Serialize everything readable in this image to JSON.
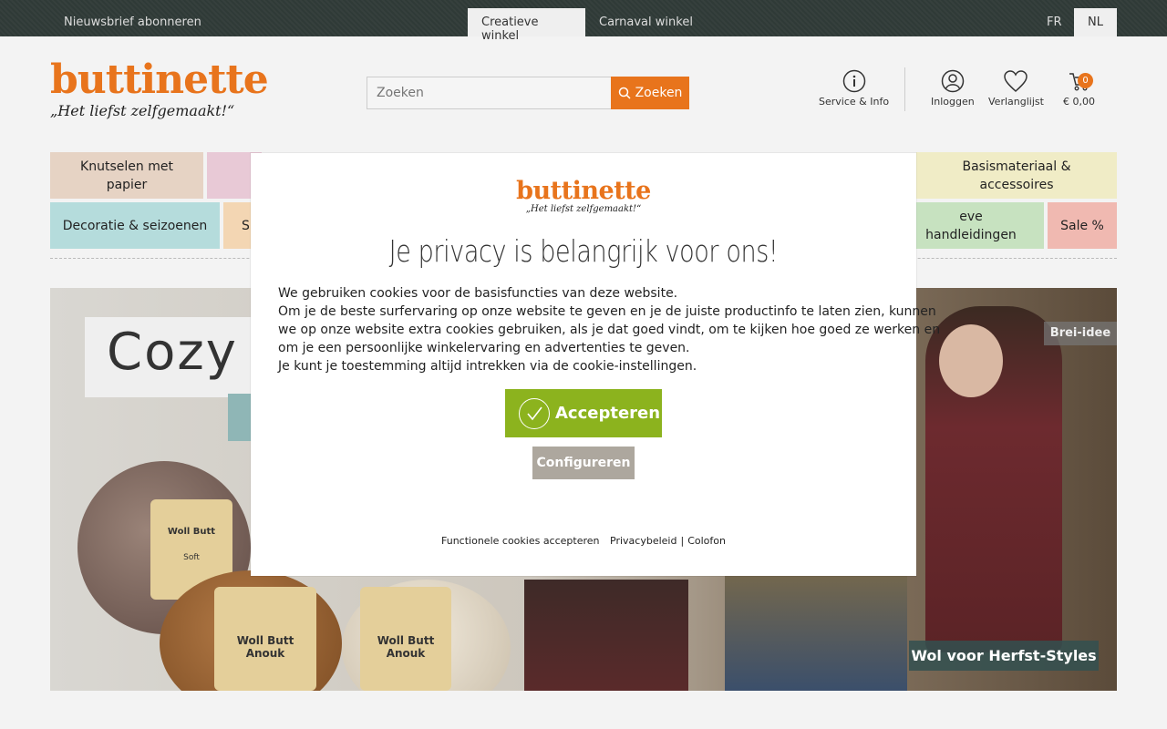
{
  "topbar": {
    "newsletter": "Nieuwsbrief abonneren",
    "tabs": [
      {
        "label": "Creatieve winkel",
        "active": true
      },
      {
        "label": "Carnaval winkel",
        "active": false
      }
    ],
    "languages": [
      {
        "label": "FR",
        "active": false
      },
      {
        "label": "NL",
        "active": true
      }
    ]
  },
  "header": {
    "logo_text": "buttinette",
    "tagline": "„Het liefst zelfgemaakt!“",
    "search": {
      "placeholder": "Zoeken",
      "button_label": "Zoeken"
    },
    "icons": {
      "service": "Service & Info",
      "login": "Inloggen",
      "wishlist": "Verlanglijst",
      "cart_total": "€ 0,00",
      "cart_count": "0"
    }
  },
  "categories": {
    "row1": [
      {
        "label": "Knutselen met papier",
        "color": "#e6d3c4"
      },
      {
        "label": "",
        "color": "#e8c9d6"
      },
      {
        "label": "Basismateriaal & accessoires",
        "color": "#f0ecc6"
      }
    ],
    "row2": [
      {
        "label": "Decoratie & seizoenen",
        "color": "#b5dcdc"
      },
      {
        "label": "Sp",
        "color": "#f3d6b3"
      },
      {
        "label": "eve handleidingen",
        "color": "#c7e2c0"
      },
      {
        "label": "Sale %",
        "color": "#f0b9b1"
      }
    ]
  },
  "hero": {
    "headline": "Cozy H",
    "badge_top": "Brei-idee",
    "badge_bottom": "Wol voor Herfst-Styles",
    "yarn_labels": [
      "Woll Butt",
      "Woll Butt",
      "Woll Butt"
    ],
    "yarn_names": [
      "Soft",
      "Anouk",
      "Anouk"
    ]
  },
  "modal": {
    "logo_text": "buttinette",
    "tagline": "„Het liefst zelfgemaakt!“",
    "title": "Je privacy is belangrijk voor ons!",
    "body": [
      "We gebruiken cookies voor de basisfuncties van deze website.",
      "Om je de beste surfervaring op onze website te geven en je de juiste productinfo te laten zien, kunnen",
      "we op onze website extra cookies gebruiken, als je dat goed vindt, om te kijken hoe goed ze werken en",
      "om je een persoonlijke winkelervaring en advertenties te geven.",
      "Je kunt je toestemming altijd intrekken via de cookie-instellingen."
    ],
    "accept_label": "Accepteren",
    "configure_label": "Configureren",
    "links": {
      "functional": "Functionele cookies accepteren",
      "privacy": "Privacybeleid",
      "separator": "|",
      "colophon": "Colofon"
    }
  },
  "colors": {
    "brand_orange": "#e8741c",
    "accept_green": "#8cb31e",
    "configure_gray": "#ada79e",
    "topbar": "#2f3a37"
  }
}
